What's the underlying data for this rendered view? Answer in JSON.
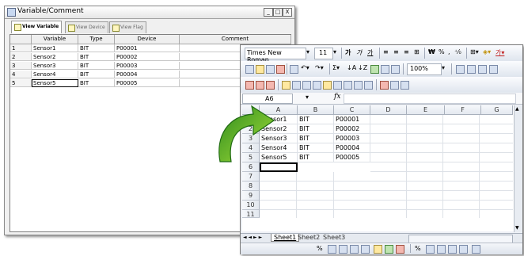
{
  "window1": {
    "title": "Variable/Comment",
    "controls": {
      "minimize": "_",
      "restore": "□",
      "close": "X"
    },
    "tabs": [
      {
        "label": "View Variable",
        "active": true
      },
      {
        "label": "View Device",
        "active": false
      },
      {
        "label": "View Flag",
        "active": false
      }
    ],
    "grid": {
      "headers": [
        "Variable",
        "Type",
        "Device",
        "Comment"
      ],
      "rows": [
        {
          "num": "1",
          "variable": "Sensor1",
          "type": "BIT",
          "device": "P00001",
          "comment": ""
        },
        {
          "num": "2",
          "variable": "Sensor2",
          "type": "BIT",
          "device": "P00002",
          "comment": ""
        },
        {
          "num": "3",
          "variable": "Sensor3",
          "type": "BIT",
          "device": "P00003",
          "comment": ""
        },
        {
          "num": "4",
          "variable": "Sensor4",
          "type": "BIT",
          "device": "P00004",
          "comment": ""
        },
        {
          "num": "5",
          "variable": "Sensor5",
          "type": "BIT",
          "device": "P00005",
          "comment": ""
        }
      ]
    }
  },
  "window2": {
    "font_name": "Times New Roman",
    "font_size": "11",
    "zoom": "100%",
    "cell_ref": "A6",
    "fx_label": "fx",
    "columns": [
      "A",
      "B",
      "C",
      "D",
      "E",
      "F",
      "G"
    ],
    "row_numbers": [
      "1",
      "2",
      "3",
      "4",
      "5",
      "6",
      "7",
      "8",
      "9",
      "10",
      "11"
    ],
    "rows": [
      {
        "a": "Sensor1",
        "b": "BIT",
        "c": "P00001"
      },
      {
        "a": "Sensor2",
        "b": "BIT",
        "c": "P00002"
      },
      {
        "a": "Sensor3",
        "b": "BIT",
        "c": "P00003"
      },
      {
        "a": "Sensor4",
        "b": "BIT",
        "c": "P00004"
      },
      {
        "a": "Sensor5",
        "b": "BIT",
        "c": "P00005"
      }
    ],
    "sheet_tabs": [
      "Sheet1",
      "Sheet2",
      "Sheet3"
    ],
    "tab_nav": "◄ ◄ ► ►",
    "bottom_pct": "%"
  },
  "colors": {
    "arrow_dark": "#2e8b1e",
    "arrow_light": "#a8e23a"
  }
}
